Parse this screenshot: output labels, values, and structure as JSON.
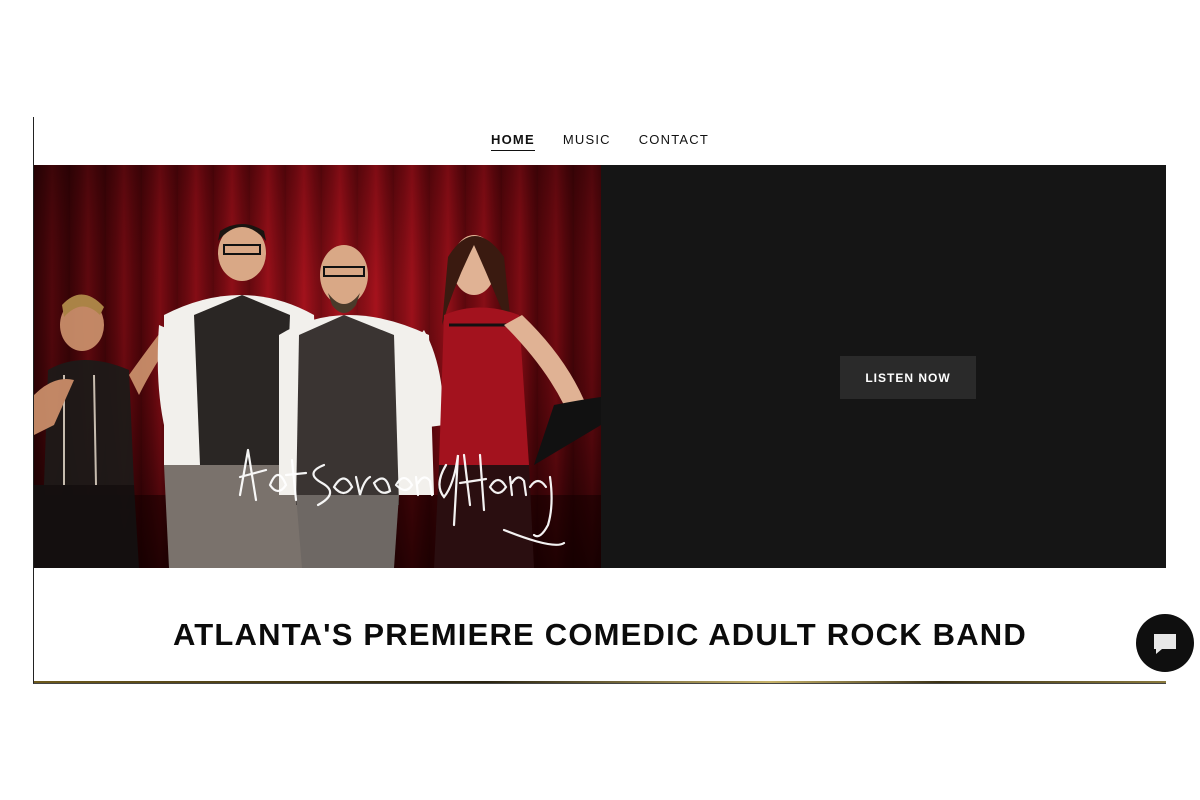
{
  "nav": {
    "items": [
      {
        "label": "HOME",
        "active": true
      },
      {
        "label": "MUSIC",
        "active": false
      },
      {
        "label": "CONTACT",
        "active": false
      }
    ]
  },
  "hero": {
    "image_logo_text": "Hot Sauce and Honey",
    "cta_label": "LISTEN NOW"
  },
  "headline": "ATLANTA'S PREMIERE COMEDIC ADULT ROCK BAND",
  "chat": {
    "icon": "chat-bubble-icon"
  },
  "colors": {
    "hero_right_bg": "#151515",
    "button_bg": "#2a2a2a",
    "curtain_red": "#b3141f",
    "text": "#0b0b0b"
  }
}
